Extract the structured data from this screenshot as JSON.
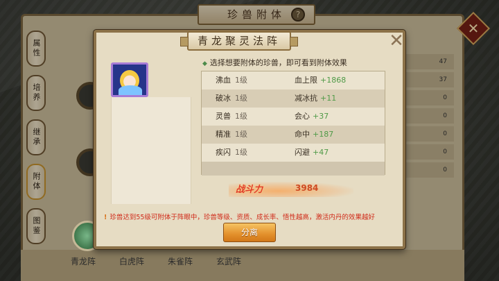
{
  "background": {
    "title": "珍兽附体",
    "help_glyph": "?",
    "side_tabs": [
      "属性",
      "培养",
      "继承",
      "附体",
      "图鉴"
    ],
    "right_values": [
      "47",
      "37",
      "0",
      "0",
      "0",
      "0",
      "0"
    ],
    "bottom_tabs": [
      "青龙阵",
      "白虎阵",
      "朱雀阵",
      "玄武阵"
    ]
  },
  "dialog": {
    "title": "青龙聚灵法阵",
    "close_glyph": "✕",
    "instruction": "选择想要附体的珍兽，即可看到附体效果",
    "rows": [
      {
        "skill": "沸血",
        "level": "1级",
        "stat": "血上限",
        "value": "+1868"
      },
      {
        "skill": "破冰",
        "level": "1级",
        "stat": "减冰抗",
        "value": "+11"
      },
      {
        "skill": "灵兽",
        "level": "1级",
        "stat": "会心",
        "value": "+37"
      },
      {
        "skill": "精准",
        "level": "1级",
        "stat": "命中",
        "value": "+187"
      },
      {
        "skill": "疾闪",
        "level": "1级",
        "stat": "闪避",
        "value": "+47"
      }
    ],
    "power_label": "战斗力",
    "power_value": "3984",
    "warning": "珍兽达到55级可附体于阵眼中，珍兽等级、资质、成长率、悟性越高，激活内丹的效果越好",
    "separate_button": "分离"
  },
  "colors": {
    "accent_green": "#4f9a47",
    "warning_red": "#d02b1a",
    "button_orange": "#e3902c"
  }
}
